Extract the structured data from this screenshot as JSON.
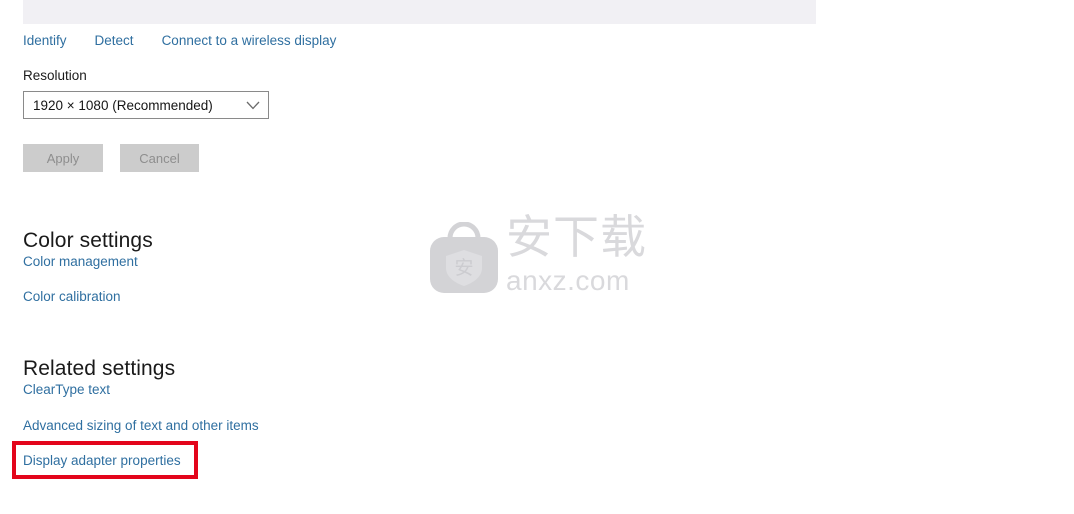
{
  "page": {
    "background_color": "#ffffff",
    "link_color": "#2f6fa0",
    "heading_color": "#1a1a1a",
    "highlight_color": "#e3051b"
  },
  "display_preview": {
    "name": "display-preview-strip"
  },
  "display_actions": {
    "links": [
      {
        "label": "Identify",
        "name": "identify-link"
      },
      {
        "label": "Detect",
        "name": "detect-link"
      },
      {
        "label": "Connect to a wireless display",
        "name": "connect-wireless-display-link"
      }
    ]
  },
  "resolution": {
    "label": "Resolution",
    "selected_value": "1920 × 1080 (Recommended)",
    "chevron_icon": "chevron-down-icon"
  },
  "buttons": {
    "apply_label": "Apply",
    "cancel_label": "Cancel",
    "state": "disabled"
  },
  "color_settings": {
    "heading": "Color settings",
    "links": [
      {
        "label": "Color management",
        "name": "color-management-link"
      },
      {
        "label": "Color calibration",
        "name": "color-calibration-link"
      }
    ]
  },
  "related_settings": {
    "heading": "Related settings",
    "links": [
      {
        "label": "ClearType text",
        "name": "cleartype-text-link"
      },
      {
        "label": "Advanced sizing of text and other items",
        "name": "advanced-sizing-link"
      },
      {
        "label": "Display adapter properties",
        "name": "display-adapter-properties-link",
        "highlighted": true
      }
    ]
  },
  "watermark": {
    "icon": "shield-bag-icon",
    "cn_text": "安下载",
    "url_text": "anxz.com",
    "shield_glyph": "安",
    "color": "#d9d9dc"
  }
}
